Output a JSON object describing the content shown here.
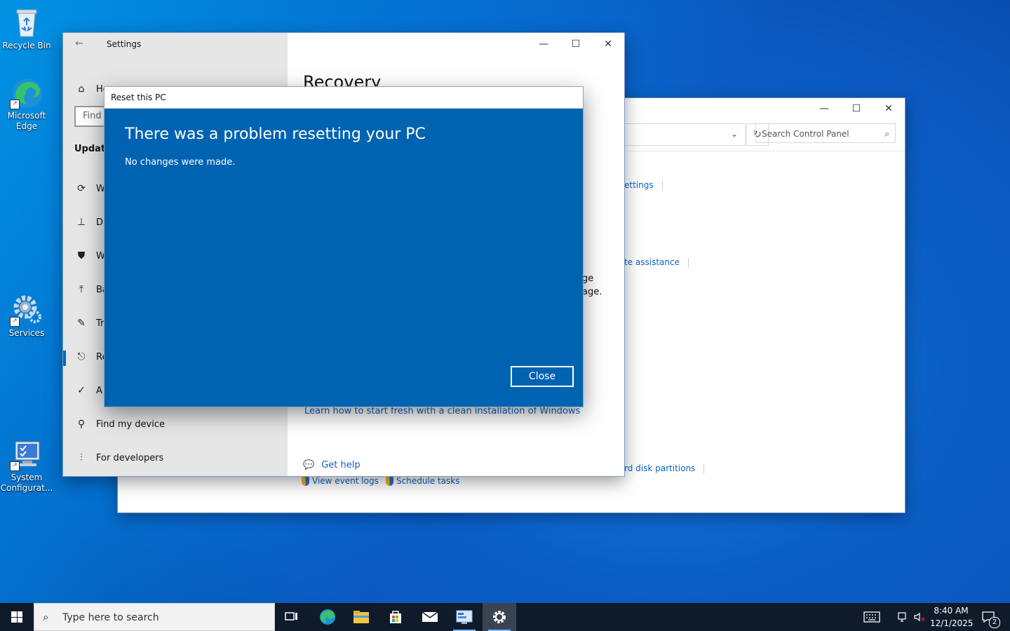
{
  "desktop": {
    "icons": [
      {
        "label": "Recycle Bin"
      },
      {
        "label": "Microsoft Edge"
      },
      {
        "label": "Services"
      },
      {
        "label": "System Configurat..."
      }
    ]
  },
  "control_panel": {
    "search_placeholder": "Search Control Panel",
    "links": {
      "settings_partial": "ettings",
      "assistance_partial": "te assistance",
      "partitions_partial": "rd disk partitions",
      "view_event_logs": "View event logs",
      "schedule_tasks": "Schedule tasks"
    }
  },
  "settings": {
    "window_title": "Settings",
    "home_label": "Home",
    "find_placeholder": "Find",
    "section_heading": "Update",
    "nav_items": [
      {
        "label": "W",
        "icon": "sync-icon"
      },
      {
        "label": "D",
        "icon": "delivery-icon"
      },
      {
        "label": "W",
        "icon": "shield-icon"
      },
      {
        "label": "Ba",
        "icon": "backup-icon"
      },
      {
        "label": "Tr",
        "icon": "wrench-icon"
      },
      {
        "label": "Re",
        "icon": "recovery-icon"
      },
      {
        "label": "A",
        "icon": "check-circle-icon"
      },
      {
        "label": "Find my device",
        "icon": "person-pin-icon"
      },
      {
        "label": "For developers",
        "icon": "developer-icon"
      }
    ],
    "page_title": "Recovery",
    "partial_text_1": "ge",
    "partial_text_2": "age.",
    "clean_install_link": "Learn how to start fresh with a clean installation of Windows",
    "get_help_link": "Get help"
  },
  "dialog": {
    "title": "Reset this PC",
    "heading": "There was a problem resetting your PC",
    "message": "No changes were made.",
    "close_button": "Close",
    "bg_color": "#0063b1"
  },
  "taskbar": {
    "search_placeholder": "Type here to search",
    "time": "8:40 AM",
    "date": "12/1/2025",
    "notification_count": "2"
  }
}
